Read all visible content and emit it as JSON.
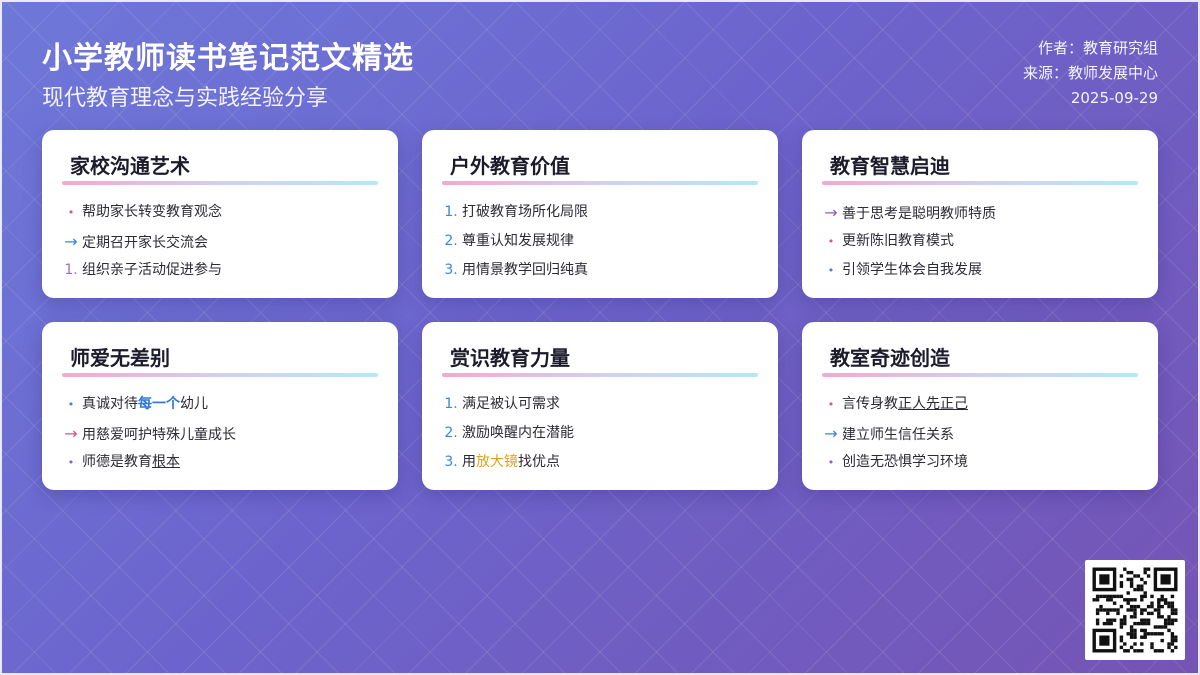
{
  "header": {
    "title": "小学教师读书笔记范文精选",
    "subtitle": "现代教育理念与实践经验分享",
    "author": "作者：教育研究组",
    "source": "来源：教师发展中心",
    "date": "2025-09-29"
  },
  "cards": [
    {
      "title": "家校沟通艺术",
      "items": [
        {
          "marker": "•",
          "text": "帮助家长转变教育观念"
        },
        {
          "marker": "→",
          "text": "定期召开家长交流会"
        },
        {
          "marker": "1.",
          "text": "组织亲子活动促进参与"
        }
      ]
    },
    {
      "title": "户外教育价值",
      "items": [
        {
          "marker": "1.",
          "text": "打破教育场所化局限"
        },
        {
          "marker": "2.",
          "text": "尊重认知发展规律"
        },
        {
          "marker": "3.",
          "text": "用情景教学回归纯真"
        }
      ]
    },
    {
      "title": "教育智慧启迪",
      "items": [
        {
          "marker": "→",
          "text": "善于思考是聪明教师特质"
        },
        {
          "marker": "•",
          "text": "更新陈旧教育模式"
        },
        {
          "marker": "•",
          "text": "引领学生体会自我发展"
        }
      ]
    },
    {
      "title": "师爱无差别",
      "items": [
        {
          "marker": "•",
          "pre": "真诚对待",
          "hl": "每一个",
          "post": "幼儿"
        },
        {
          "marker": "→",
          "text": "用慈爱呵护特殊儿童成长"
        },
        {
          "marker": "•",
          "pre": "师德是教育",
          "hl": "根本",
          "post": ""
        }
      ]
    },
    {
      "title": "赏识教育力量",
      "items": [
        {
          "marker": "1.",
          "text": "满足被认可需求"
        },
        {
          "marker": "2.",
          "text": "激励唤醒内在潜能"
        },
        {
          "marker": "3.",
          "pre": "用",
          "hl": "放大镜",
          "post": "找优点"
        }
      ]
    },
    {
      "title": "教室奇迹创造",
      "items": [
        {
          "marker": "•",
          "pre": "言传身教",
          "hl": "正人先正己",
          "post": ""
        },
        {
          "marker": "→",
          "text": "建立师生信任关系"
        },
        {
          "marker": "•",
          "text": "创造无恐惧学习环境"
        }
      ]
    }
  ],
  "colors": {
    "bg_start": "#6e78d9",
    "bg_end": "#7554b4",
    "accent_pink": "#d0568a",
    "accent_blue": "#3a86d8",
    "accent_purple": "#8f5fc4",
    "highlight_yellow": "#e0a21a"
  },
  "qr_code": {
    "icon": "qr-code-icon"
  }
}
